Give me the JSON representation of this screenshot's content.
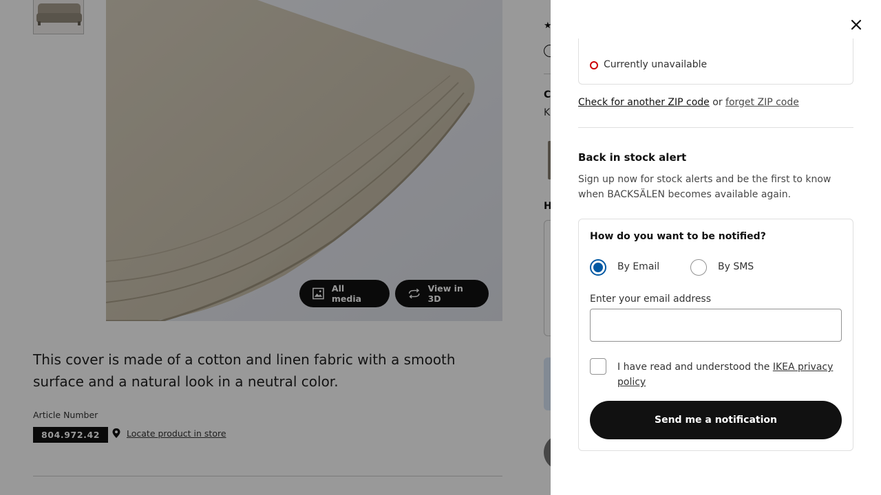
{
  "background_page": {
    "media_buttons": {
      "all_media": "All media",
      "view_3d": "View in 3D"
    },
    "description": "This cover is made of a cotton and linen fabric with a smooth surface and a natural look in a neutral color.",
    "article_number_label": "Article Number",
    "article_number": "804.972.42",
    "locate_link": "Locate product in store",
    "peek": {
      "letter_c": "C",
      "letter_k": "K",
      "letter_h": "H"
    }
  },
  "panel": {
    "availability": {
      "status": "Currently unavailable",
      "status_color": "#cc0008"
    },
    "zip": {
      "check_link": "Check for another ZIP code",
      "or": "or",
      "forget_link": "forget ZIP code"
    },
    "alert": {
      "title": "Back in stock alert",
      "description": "Sign up now for stock alerts and be the first to know when BACKSÄLEN becomes available again."
    },
    "form": {
      "question": "How do you want to be notified?",
      "options": [
        {
          "label": "By Email",
          "selected": true
        },
        {
          "label": "By SMS",
          "selected": false
        }
      ],
      "email_label": "Enter your email address",
      "email_value": "",
      "consent_text": "I have read and understood the",
      "consent_link": "IKEA privacy policy",
      "consent_checked": false,
      "submit_label": "Send me a notification"
    },
    "accent_color": "#0058a3"
  }
}
